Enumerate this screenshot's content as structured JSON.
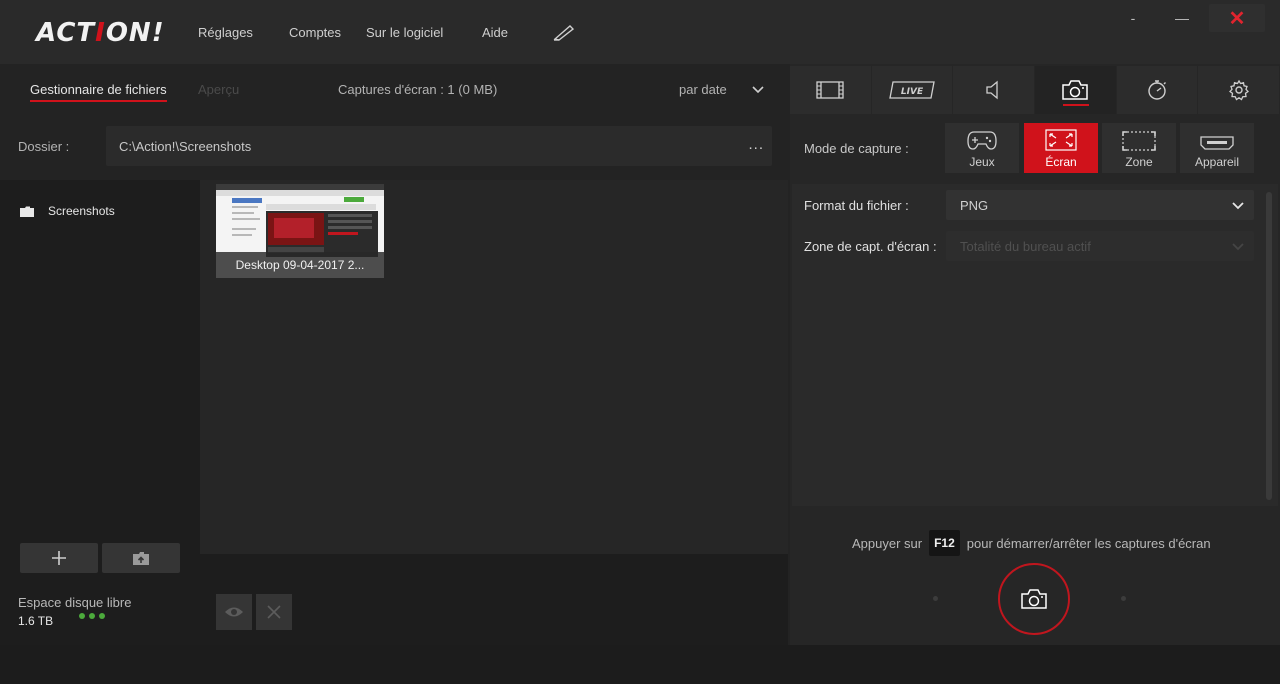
{
  "app": {
    "logo_a": "ACT",
    "logo_b": "I",
    "logo_c": "ON!"
  },
  "menu": {
    "settings": "Réglages",
    "accounts": "Comptes",
    "about": "Sur le logiciel",
    "help": "Aide"
  },
  "window": {
    "minimize": "-",
    "maximize": "—",
    "close": "✕"
  },
  "file_manager": {
    "tab_manager": "Gestionnaire de fichiers",
    "tab_preview": "Aperçu",
    "capture_count": "Captures d'écran : 1 (0 MB)",
    "sort_by": "par date",
    "folder_label": "Dossier :",
    "folder_path": "C:\\Action!\\Screenshots",
    "folder_browse": "...",
    "tree_items": [
      {
        "label": "Screenshots"
      }
    ],
    "files": [
      {
        "caption": "Desktop 09-04-2017 2..."
      }
    ],
    "disk_label": "Espace disque libre",
    "disk_value": "1.6 TB"
  },
  "right": {
    "tabs": [
      "video-icon",
      "live-icon",
      "audio-icon",
      "camera-icon",
      "timer-icon",
      "settings-icon"
    ],
    "live_text": "LIVE",
    "mode_label": "Mode de capture :",
    "modes": [
      {
        "label": "Jeux",
        "icon": "gamepad-icon",
        "active": false
      },
      {
        "label": "Écran",
        "icon": "fullscreen-icon",
        "active": true
      },
      {
        "label": "Zone",
        "icon": "area-icon",
        "active": false
      },
      {
        "label": "Appareil",
        "icon": "device-icon",
        "active": false
      }
    ],
    "format_label": "Format du fichier :",
    "format_value": "PNG",
    "zone_label": "Zone de capt. d'écran :",
    "zone_value": "Totalité du bureau actif",
    "hint_pre": "Appuyer sur",
    "hint_key": "F12",
    "hint_post": "pour démarrer/arrêter les captures d'écran"
  },
  "colors": {
    "accent": "#d0121b",
    "disk_ok": "#4caa3c"
  }
}
